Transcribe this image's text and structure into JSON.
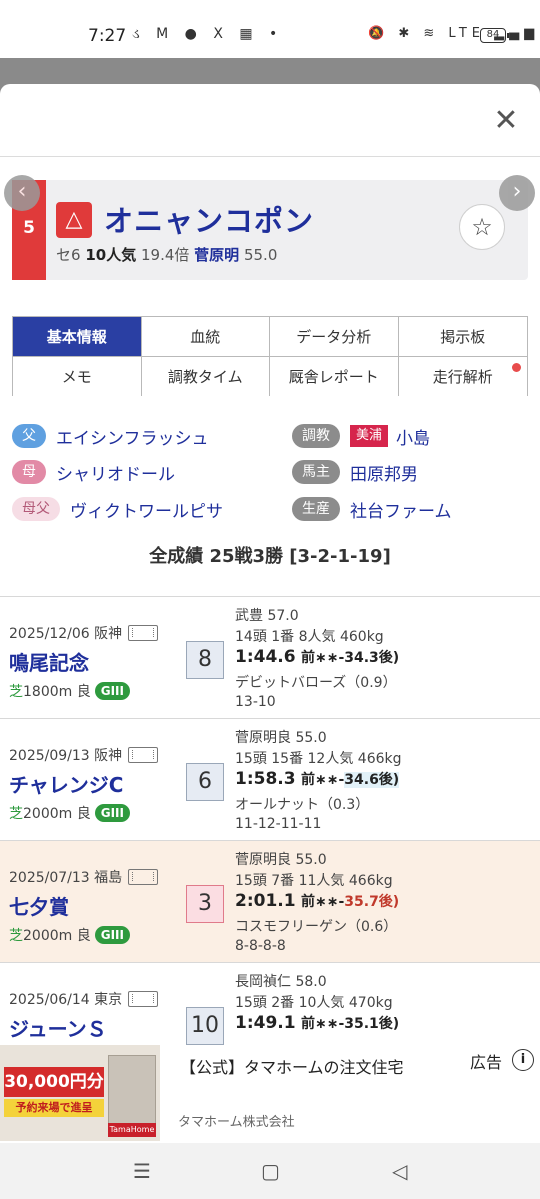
{
  "status_bar": {
    "time": "7:27",
    "left_icons": "ડ M ● X ▦ •",
    "right_icons": "🔕 ✱ ≋ LTE ▂▄▆",
    "battery": "84"
  },
  "modal": {
    "close": "✕"
  },
  "horse": {
    "post": "5",
    "mark": "△",
    "name": "オニャンコポン",
    "sex_age": "セ6",
    "popularity": "10人気",
    "odds": "19.4倍",
    "jockey": "菅原明",
    "weight": "55.0",
    "fav_icon": "☆",
    "prev": "‹",
    "next": "›"
  },
  "tabs": [
    {
      "label": "基本情報"
    },
    {
      "label": "血統"
    },
    {
      "label": "データ分析"
    },
    {
      "label": "掲示板"
    },
    {
      "label": "メモ"
    },
    {
      "label": "調教タイム"
    },
    {
      "label": "厩舎レポート"
    },
    {
      "label": "走行解析"
    }
  ],
  "info": {
    "sire_label": "父",
    "sire": "エイシンフラッシュ",
    "dam_label": "母",
    "dam": "シャリオドール",
    "damsire_label": "母父",
    "damsire": "ヴィクトワールピサ",
    "trainer_label": "調教",
    "trainer_belong": "美浦",
    "trainer": "小島",
    "owner_label": "馬主",
    "owner": "田原邦男",
    "breeder_label": "生産",
    "breeder": "社台ファーム"
  },
  "record_title": "全成績 25戦3勝 [3-2-1-19]",
  "races": [
    {
      "date": "2025/12/06 阪神",
      "name": "鳴尾記念",
      "surface": "芝",
      "course": "1800m 良",
      "grade": "GIII",
      "finish": "8",
      "jockey_line": "武豊 57.0",
      "entry_line": "14頭 1番 8人気 460kg",
      "time": "1:44.6",
      "pos": "前∗∗-34.3後)",
      "winner": "デビットバローズ（0.9）",
      "corners": "13-10"
    },
    {
      "date": "2025/09/13 阪神",
      "name": "チャレンジC",
      "surface": "芝",
      "course": "2000m 良",
      "grade": "GIII",
      "finish": "6",
      "jockey_line": "菅原明良 55.0",
      "entry_line": "15頭 15番 12人気 466kg",
      "time": "1:58.3",
      "pos_a": "前∗∗-",
      "pos_b": "34.6後)",
      "winner": "オールナット（0.3）",
      "corners": "11-12-11-11"
    },
    {
      "date": "2025/07/13 福島",
      "name": "七夕賞",
      "surface": "芝",
      "course": "2000m 良",
      "grade": "GIII",
      "finish": "3",
      "jockey_line": "菅原明良 55.0",
      "entry_line": "15頭 7番 11人気 466kg",
      "time": "2:01.1",
      "pos_a": "前∗∗-",
      "pos_b": "35.7後)",
      "winner": "コスモフリーゲン（0.6）",
      "corners": "8-8-8-8"
    },
    {
      "date": "2025/06/14 東京",
      "name": "ジューンＳ",
      "finish": "10",
      "jockey_line": "長岡禎仁 58.0",
      "entry_line": "15頭 2番 10人気 470kg",
      "time": "1:49.1",
      "pos": "前∗∗-35.1後)"
    }
  ],
  "ad": {
    "title": "【公式】タマホームの注文住宅",
    "label": "広告",
    "info": "i",
    "sponsor": "タマホーム株式会社",
    "img_red": "30,000円分",
    "img_yellow": "予約来場で進呈",
    "img_brand": "TamaHome"
  },
  "navbar": {
    "menu": "☰",
    "home": "▢",
    "back": "◁"
  }
}
